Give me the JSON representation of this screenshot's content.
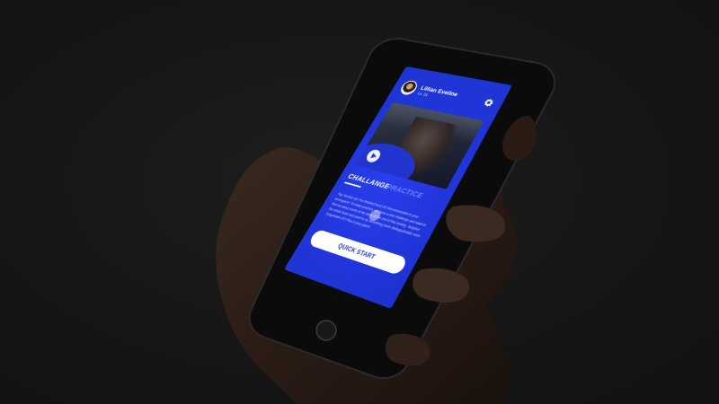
{
  "profile": {
    "name": "Lillian Eveline",
    "meta": "Lv. 21"
  },
  "tabs": {
    "challange": "CHALLANGE",
    "practice": "PRACTICE"
  },
  "description": "Yay, thumbs up! You finished level 20! Recommended in your workspace? To make practice, we have a new challenge and want to find out about some of the tasks in the rest of this ending. Surprise the whole team and want to try something more distinguishable even Suspended 20? Plus it your place!",
  "button": {
    "quick_start": "QUICK START"
  },
  "icons": {
    "settings": "gear-icon",
    "play": "play-icon"
  },
  "colors": {
    "accent": "#1f35d6",
    "tab_inactive": "#6f80ff",
    "background": "#161616",
    "phone_body": "#0b0b0c",
    "hand": "#2a1c15"
  }
}
